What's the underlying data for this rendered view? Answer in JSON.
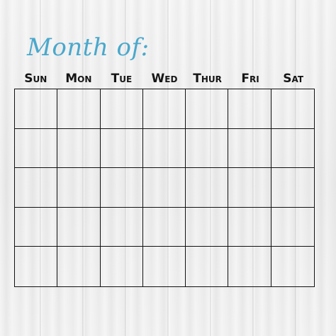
{
  "title": "Month of:",
  "weekdays": [
    "Sun",
    "Mon",
    "Tue",
    "Wed",
    "Thur",
    "Fri",
    "Sat"
  ],
  "grid": {
    "rows": 5,
    "columns": 7
  },
  "colors": {
    "title": "#4aa8cc",
    "grid_lines": "#111111",
    "background": "#eaeaea"
  }
}
